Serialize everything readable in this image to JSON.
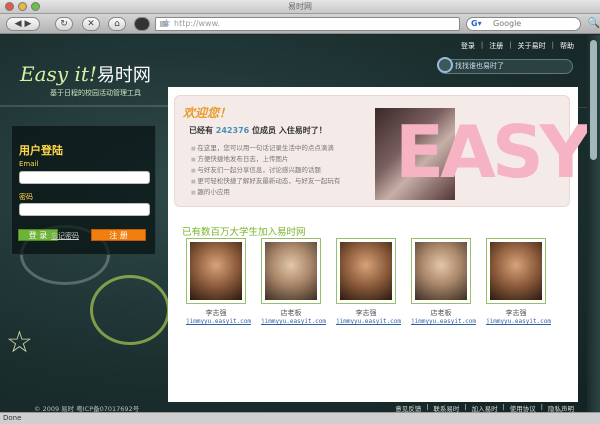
{
  "browser": {
    "window_title": "易时网",
    "url": "http://www.",
    "search_placeholder": "Google",
    "status": "Done"
  },
  "header": {
    "links": [
      "登录",
      "注册",
      "关于易时",
      "帮助"
    ],
    "logo_en": "Easy it!",
    "logo_cn": "易时网",
    "tagline": "基于日程的校园活动管理工具",
    "find_placeholder": "找找谁也易时了"
  },
  "login": {
    "title": "用户登陆",
    "email_label": "Email",
    "password_label": "密码",
    "login_button": "登 录",
    "forgot_link": "忘记密码",
    "register_button": "注 册"
  },
  "welcome": {
    "greeting": "欢迎您！",
    "count_prefix": "已经有",
    "count": "242376",
    "count_suffix": "位成员 入住易时了！",
    "features": [
      "在这里，您可以用一句话记录生活中的点点滴滴",
      "方便快捷地发布日志，上传图片",
      "与好友们一起分享信息，讨论感兴趣的话题",
      "更可轻松快捷了解好友最新动态，与好友一起玩有",
      "趣的小应用"
    ],
    "banner_text": "EASY"
  },
  "members": {
    "title": "已有数百万大学生加入易时网",
    "list": [
      {
        "name": "李志强",
        "link": "jimmyyu.easyit.com"
      },
      {
        "name": "店老板",
        "link": "jimmyyu.easyit.com"
      },
      {
        "name": "李志强",
        "link": "jimmyyu.easyit.com"
      },
      {
        "name": "店老板",
        "link": "jimmyyu.easyit.com"
      },
      {
        "name": "李志强",
        "link": "jimmyyu.easyit.com"
      }
    ]
  },
  "footer": {
    "copyright": "© 2009 易时 粤ICP备07017692号",
    "links": [
      "意见反馈",
      "联系易时",
      "加入易时",
      "使用协议",
      "隐私声明"
    ]
  },
  "colors": {
    "accent_yellow": "#ffd84a",
    "register_orange": "#f07f10",
    "login_green": "#6fb23a",
    "section_green": "#7ab32a"
  }
}
